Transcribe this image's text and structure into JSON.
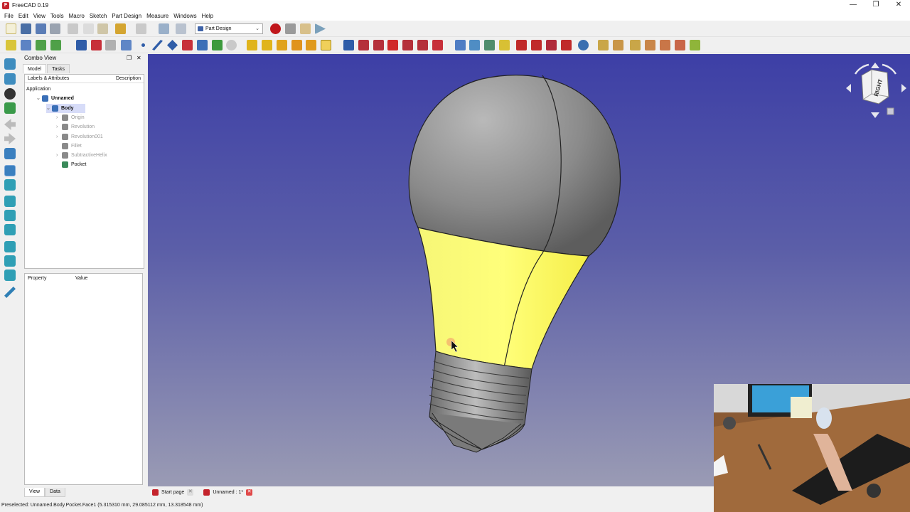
{
  "window": {
    "title": "FreeCAD 0.19",
    "controls": [
      "—",
      "❐",
      "✕"
    ]
  },
  "menu": [
    "File",
    "Edit",
    "View",
    "Tools",
    "Macro",
    "Sketch",
    "Part Design",
    "Measure",
    "Windows",
    "Help"
  ],
  "workbench": {
    "selected": "Part Design"
  },
  "combo": {
    "title": "Combo View",
    "tabs": [
      "Model",
      "Tasks"
    ],
    "tree_headers": {
      "labels": "Labels & Attributes",
      "description": "Description"
    },
    "tree": [
      {
        "label": "Application",
        "level": 0,
        "state": "normal"
      },
      {
        "label": "Unnamed",
        "level": 1,
        "state": "bold"
      },
      {
        "label": "Body",
        "level": 2,
        "state": "selected"
      },
      {
        "label": "Origin",
        "level": 3,
        "state": "dim"
      },
      {
        "label": "Revolution",
        "level": 3,
        "state": "dim"
      },
      {
        "label": "Revolution001",
        "level": 3,
        "state": "dim"
      },
      {
        "label": "Fillet",
        "level": 3,
        "state": "dim"
      },
      {
        "label": "SubtractiveHelix",
        "level": 3,
        "state": "dim"
      },
      {
        "label": "Pocket",
        "level": 3,
        "state": "normal"
      }
    ],
    "prop_headers": {
      "property": "Property",
      "value": "Value"
    },
    "bottom_tabs": [
      "View",
      "Data"
    ]
  },
  "navcube": {
    "face": "RIGHT"
  },
  "doc_tabs": [
    {
      "label": "Start page"
    },
    {
      "label": "Unnamed : 1*"
    }
  ],
  "status": "Preselected: Unnamed.Body.Pocket.Face1 (5.315310 mm, 29.085112 mm, 13.318548 mm)",
  "colors": {
    "viewport_top": "#3d3fa6",
    "viewport_bottom": "#9a9bb4",
    "highlight_face": "#ffff66",
    "selection": "#d7dcf8"
  }
}
